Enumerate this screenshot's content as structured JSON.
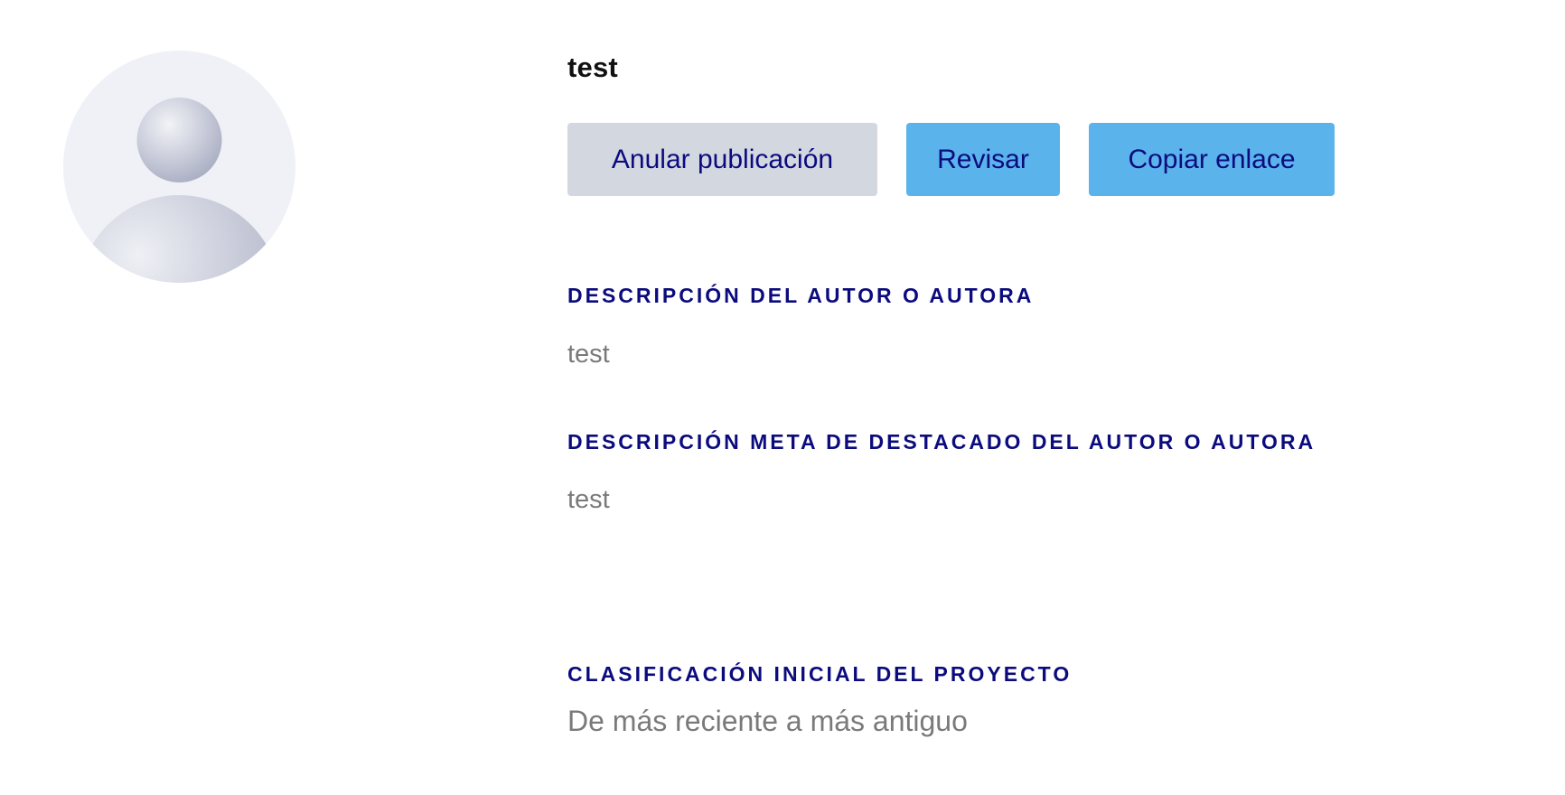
{
  "profile": {
    "name": "test",
    "avatar_icon": "user-placeholder-icon"
  },
  "actions": {
    "unpublish_label": "Anular publicación",
    "review_label": "Revisar",
    "copy_link_label": "Copiar enlace"
  },
  "sections": {
    "author_description": {
      "label": "Descripción del autor o autora",
      "value": "test"
    },
    "featured_meta_description": {
      "label": "Descripción meta de destacado del autor o autora",
      "value": "test"
    },
    "initial_sort": {
      "label": "Clasificación inicial del proyecto",
      "value": "De más reciente a más antiguo"
    }
  },
  "colors": {
    "accent_text": "#0b0b7e",
    "button_primary": "#5ab3eb",
    "button_secondary": "#d3d7e0",
    "muted_text": "#7a7a7a"
  }
}
